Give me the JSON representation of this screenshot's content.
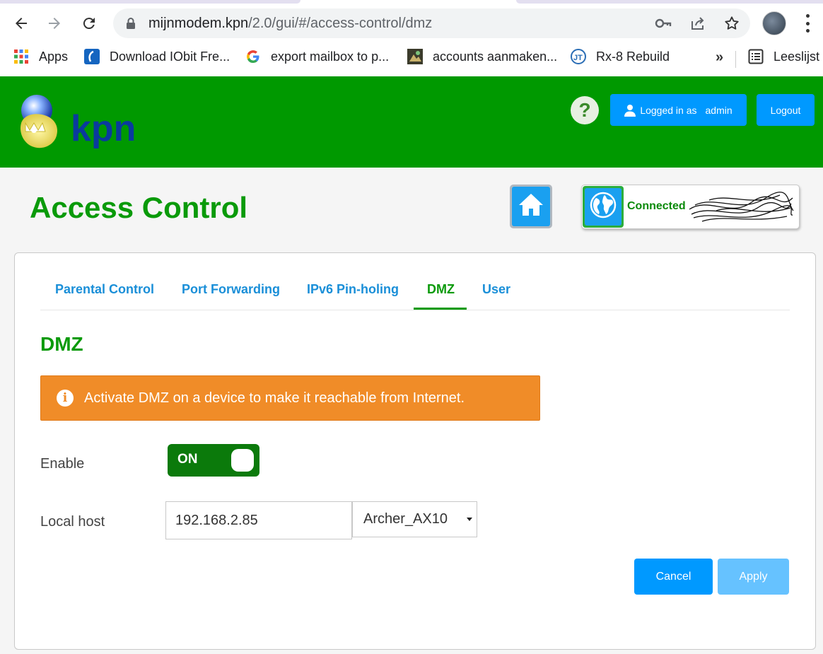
{
  "browser": {
    "url_host": "mijnmodem.kpn",
    "url_path": "/2.0/gui/#/access-control/dmz",
    "bookmarks": [
      {
        "label": "Apps",
        "icon": "apps-grid-icon"
      },
      {
        "label": "Download IObit Fre...",
        "icon": "iobit-icon"
      },
      {
        "label": "export mailbox to p...",
        "icon": "google-icon"
      },
      {
        "label": "accounts aanmaken...",
        "icon": "site-favicon-icon"
      },
      {
        "label": "Rx-8 Rebuild",
        "icon": "jt-icon"
      }
    ],
    "more_label": "»",
    "reading_list_label": "Leeslijst"
  },
  "header": {
    "help_label": "?",
    "logged_in_prefix": "Logged in as",
    "username": "admin",
    "logout_label": "Logout",
    "brand_color": "#009900"
  },
  "page": {
    "title": "Access Control",
    "status_label": "Connected"
  },
  "tabs": [
    {
      "label": "Parental Control",
      "active": false
    },
    {
      "label": "Port Forwarding",
      "active": false
    },
    {
      "label": "IPv6 Pin-holing",
      "active": false
    },
    {
      "label": "DMZ",
      "active": true
    },
    {
      "label": "User",
      "active": false
    }
  ],
  "dmz": {
    "section_title": "DMZ",
    "info_message": "Activate DMZ on a device to make it reachable from Internet.",
    "enable_label": "Enable",
    "toggle_state": "ON",
    "local_host_label": "Local host",
    "local_host_ip": "192.168.2.85",
    "device_selected": "Archer_AX10",
    "cancel_label": "Cancel",
    "apply_label": "Apply"
  }
}
